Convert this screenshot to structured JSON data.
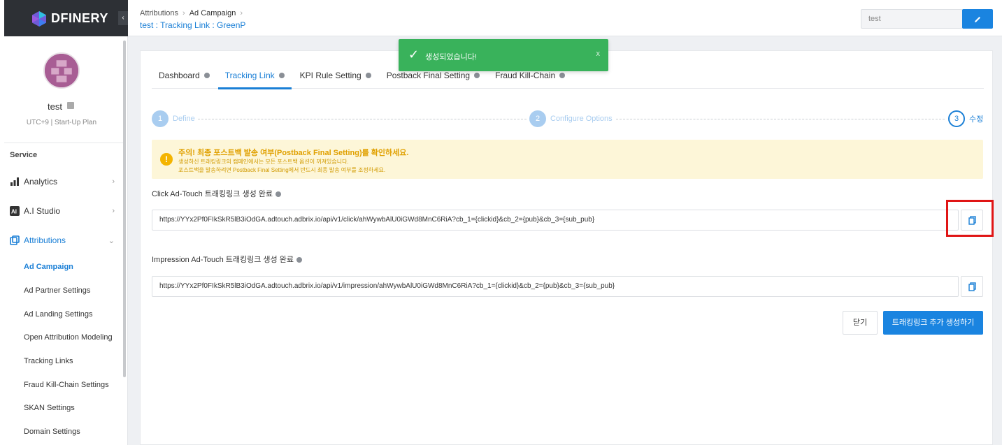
{
  "brand": {
    "name": "DFINERY"
  },
  "user": {
    "name": "test",
    "meta": "UTC+9  |  Start-Up Plan"
  },
  "sidebar": {
    "section": "Service",
    "items": [
      {
        "label": "Analytics"
      },
      {
        "label": "A.I Studio"
      },
      {
        "label": "Attributions"
      }
    ],
    "sub_items": [
      {
        "label": "Ad Campaign"
      },
      {
        "label": "Ad Partner Settings"
      },
      {
        "label": "Ad Landing Settings"
      },
      {
        "label": "Open Attribution Modeling"
      },
      {
        "label": "Tracking Links"
      },
      {
        "label": "Fraud Kill-Chain Settings"
      },
      {
        "label": "SKAN Settings"
      },
      {
        "label": "Domain Settings"
      }
    ]
  },
  "header": {
    "breadcrumb": [
      "Attributions",
      "Ad Campaign"
    ],
    "subtitle": "test : Tracking Link : GreenP",
    "input_value": "test"
  },
  "tabs": [
    {
      "label": "Dashboard"
    },
    {
      "label": "Tracking Link"
    },
    {
      "label": "KPI Rule Setting"
    },
    {
      "label": "Postback Final Setting"
    },
    {
      "label": "Fraud Kill-Chain"
    }
  ],
  "stepper": [
    {
      "num": "1",
      "label": "Define"
    },
    {
      "num": "2",
      "label": "Configure Options"
    },
    {
      "num": "3",
      "label": "수정"
    }
  ],
  "warning": {
    "icon": "!",
    "title": "주의! 최종 포스트백 발송 여부(Postback Final Setting)를 확인하세요.",
    "line1": "생성하신 트래킹링크의 캠페인에서는 모든 포스트백 옵션이 꺼져있습니다.",
    "line2": "포스트백을 발송하려면 Postback Final Setting에서 반드시 최종 발송 여부를 조정하세요."
  },
  "click_link": {
    "label": "Click Ad-Touch 트래킹링크 생성 완료",
    "url": "https://YYx2Pf0FIkSkR5lB3iOdGA.adtouch.adbrix.io/api/v1/click/ahWywbAlU0iGWd8MnC6RiA?cb_1={clickid}&cb_2={pub}&cb_3={sub_pub}"
  },
  "impression_link": {
    "label": "Impression Ad-Touch 트래킹링크 생성 완료",
    "url": "https://YYx2Pf0FIkSkR5lB3iOdGA.adtouch.adbrix.io/api/v1/impression/ahWywbAlU0iGWd8MnC6RiA?cb_1={clickid}&cb_2={pub}&cb_3={sub_pub}"
  },
  "buttons": {
    "close": "닫기",
    "add_more": "트래킹링크 추가 생성하기"
  },
  "toast": {
    "message": "생성되었습니다!",
    "close": "x"
  },
  "colors": {
    "accent": "#1a84e0",
    "success": "#39b25b",
    "warning": "#f4b400",
    "highlight": "#e01515"
  }
}
